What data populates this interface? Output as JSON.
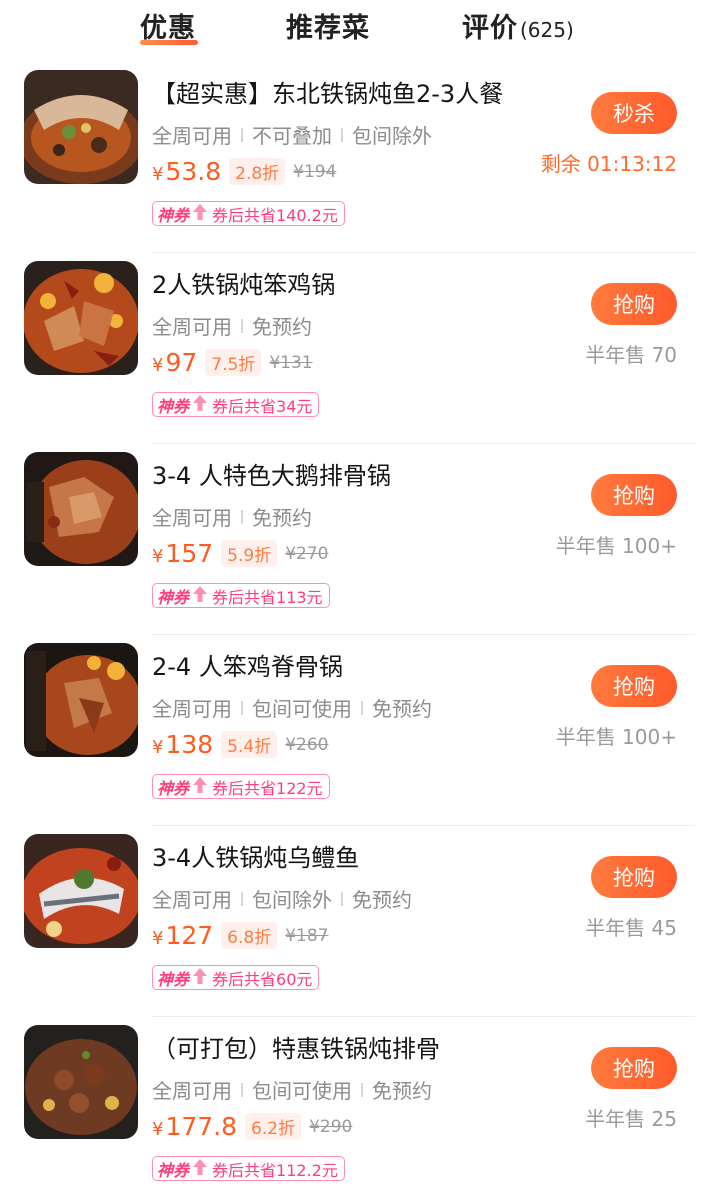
{
  "tabs": {
    "deals_label": "优惠",
    "recommended_label": "推荐菜",
    "reviews_label": "评价",
    "reviews_count": "(625)"
  },
  "coupon_logo": "神券",
  "deals": [
    {
      "title": "【超实惠】东北铁锅炖鱼2-3人餐",
      "tags": [
        "全周可用",
        "不可叠加",
        "包间除外"
      ],
      "currency": "¥",
      "price": "53.8",
      "discount": "2.8折",
      "original_price": "¥194",
      "coupon_text": "券后共省140.2元",
      "button_label": "秒杀",
      "status_text": "剩余 01:13:12"
    },
    {
      "title": "2人铁锅炖笨鸡锅",
      "tags": [
        "全周可用",
        "免预约"
      ],
      "currency": "¥",
      "price": "97",
      "discount": "7.5折",
      "original_price": "¥131",
      "coupon_text": "券后共省34元",
      "button_label": "抢购",
      "status_text": "半年售 70"
    },
    {
      "title": "3-4 人特色大鹅排骨锅",
      "tags": [
        "全周可用",
        "免预约"
      ],
      "currency": "¥",
      "price": "157",
      "discount": "5.9折",
      "original_price": "¥270",
      "coupon_text": "券后共省113元",
      "button_label": "抢购",
      "status_text": "半年售 100+"
    },
    {
      "title": "2-4 人笨鸡脊骨锅",
      "tags": [
        "全周可用",
        "包间可使用",
        "免预约"
      ],
      "currency": "¥",
      "price": "138",
      "discount": "5.4折",
      "original_price": "¥260",
      "coupon_text": "券后共省122元",
      "button_label": "抢购",
      "status_text": "半年售 100+"
    },
    {
      "title": "3-4人铁锅炖乌鳢鱼",
      "tags": [
        "全周可用",
        "包间除外",
        "免预约"
      ],
      "currency": "¥",
      "price": "127",
      "discount": "6.8折",
      "original_price": "¥187",
      "coupon_text": "券后共省60元",
      "button_label": "抢购",
      "status_text": "半年售 45"
    },
    {
      "title": "（可打包）特惠铁锅炖排骨",
      "tags": [
        "全周可用",
        "包间可使用",
        "免预约"
      ],
      "currency": "¥",
      "price": "177.8",
      "discount": "6.2折",
      "original_price": "¥290",
      "coupon_text": "券后共省112.2元",
      "button_label": "抢购",
      "status_text": "半年售 25"
    }
  ],
  "colors": {
    "accent": "#ff5a1f",
    "button": "#ff6633",
    "coupon": "#ff3d7a",
    "muted": "#9a9a9a"
  }
}
